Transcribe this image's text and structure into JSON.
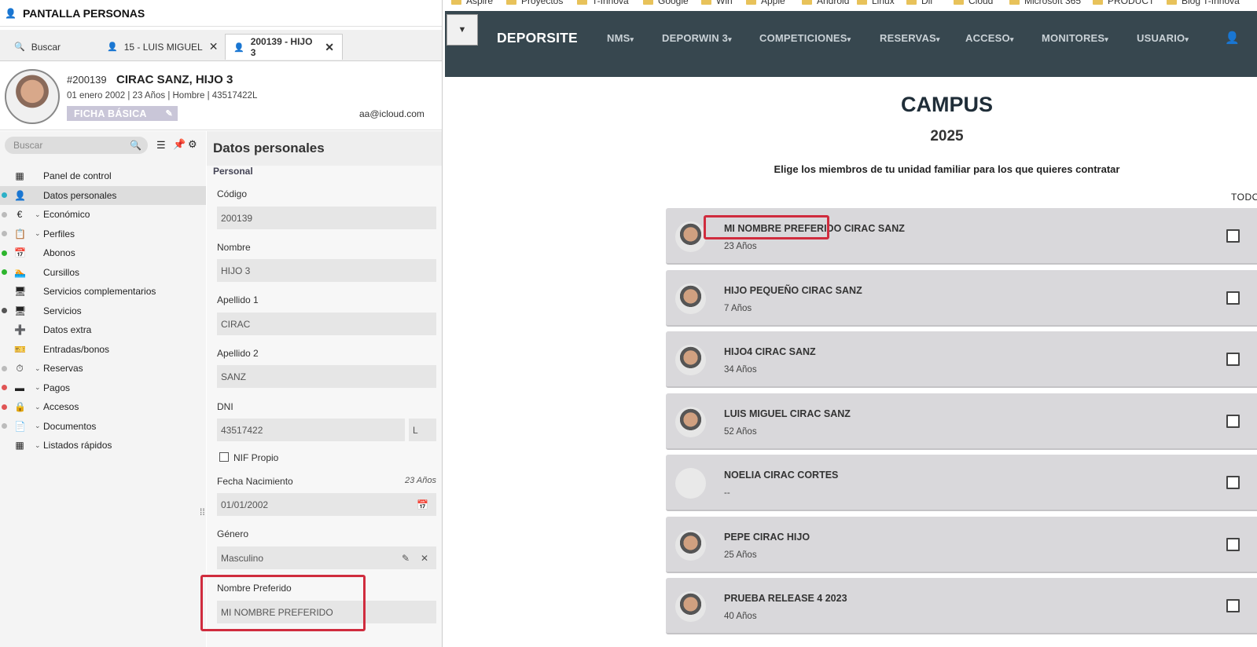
{
  "left": {
    "title": "PANTALLA PERSONAS",
    "tabs": [
      {
        "label": "Buscar"
      },
      {
        "label": "15 - LUIS MIGUEL"
      },
      {
        "label": "200139 - HIJO 3"
      }
    ],
    "person": {
      "id": "#200139",
      "name": "CIRAC SANZ, HIJO 3",
      "info": "01 enero 2002 | 23 Años | Hombre | 43517422L",
      "badge": "FICHA BÁSICA",
      "email": "aa@icloud.com"
    },
    "sidebar": {
      "search_placeholder": "Buscar",
      "items": [
        {
          "label": "Panel de control",
          "dot": "",
          "chev": false
        },
        {
          "label": "Datos personales",
          "dot": "#2bb0c7",
          "chev": false
        },
        {
          "label": "Económico",
          "dot": "#bbbbbb",
          "chev": true
        },
        {
          "label": "Perfiles",
          "dot": "#bbbbbb",
          "chev": true
        },
        {
          "label": "Abonos",
          "dot": "#2db52d",
          "chev": false
        },
        {
          "label": "Cursillos",
          "dot": "#2db52d",
          "chev": false
        },
        {
          "label": "Servicios complementarios",
          "dot": "",
          "chev": false
        },
        {
          "label": "Servicios",
          "dot": "#555555",
          "chev": false
        },
        {
          "label": "Datos extra",
          "dot": "",
          "chev": false
        },
        {
          "label": "Entradas/bonos",
          "dot": "",
          "chev": false
        },
        {
          "label": "Reservas",
          "dot": "#bbbbbb",
          "chev": true
        },
        {
          "label": "Pagos",
          "dot": "#e05555",
          "chev": true
        },
        {
          "label": "Accesos",
          "dot": "#e05555",
          "chev": true
        },
        {
          "label": "Documentos",
          "dot": "#bbbbbb",
          "chev": true
        },
        {
          "label": "Listados rápidos",
          "dot": "",
          "chev": true
        }
      ]
    },
    "form": {
      "title": "Datos personales",
      "section": "Personal",
      "codigo_label": "Código",
      "codigo": "200139",
      "nombre_label": "Nombre",
      "nombre": "HIJO 3",
      "apellido1_label": "Apellido 1",
      "apellido1": "CIRAC",
      "apellido2_label": "Apellido 2",
      "apellido2": "SANZ",
      "dni_label": "DNI",
      "dni": "43517422",
      "dni_letter": "L",
      "nif_label": "NIF Propio",
      "fecha_label": "Fecha Nacimiento",
      "fecha_age": "23 Años",
      "fecha": "01/01/2002",
      "genero_label": "Género",
      "genero": "Masculino",
      "pref_label": "Nombre Preferido",
      "pref": "MI NOMBRE PREFERIDO"
    }
  },
  "right": {
    "bookmarks": [
      "Aspire",
      "Proyectos",
      "T-Innova",
      "Google",
      "Win",
      "Apple",
      "Android",
      "Linux",
      "Dll",
      "Cloud",
      "Microsoft 365",
      "PRODUCT",
      "Blog T-Innova"
    ],
    "logo": "DEPORSITE",
    "menu": [
      "NMS",
      "DEPORWIN 3",
      "COMPETICIONES",
      "RESERVAS",
      "ACCESO",
      "MONITORES",
      "USUARIO"
    ],
    "title": "CAMPUS",
    "year": "2025",
    "instruction": "Elige los miembros de tu unidad familiar para los que quieres contratar",
    "todo": "TODO",
    "members": [
      {
        "name": "MI NOMBRE PREFERIDO CIRAC SANZ",
        "age": "23 Años",
        "photo": true
      },
      {
        "name": "HIJO PEQUEÑO CIRAC SANZ",
        "age": "7 Años",
        "photo": true
      },
      {
        "name": "HIJO4 CIRAC SANZ",
        "age": "34 Años",
        "photo": true
      },
      {
        "name": "LUIS MIGUEL CIRAC SANZ",
        "age": "52 Años",
        "photo": true
      },
      {
        "name": "NOELIA CIRAC CORTES",
        "age": "--",
        "photo": false
      },
      {
        "name": "PEPE CIRAC HIJO",
        "age": "25 Años",
        "photo": true
      },
      {
        "name": "PRUEBA RELEASE 4 2023",
        "age": "40 Años",
        "photo": true
      }
    ]
  },
  "colors": {
    "nav": "#37474f",
    "highlight": "#d02c3e",
    "badge": "#c9c6d8"
  }
}
